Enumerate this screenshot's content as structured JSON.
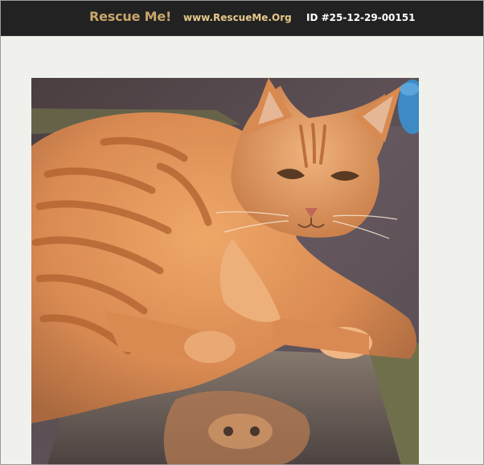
{
  "header": {
    "brand": "Rescue Me!",
    "site": "www.RescueMe.Org",
    "pet_id": "ID #25-12-29-00151"
  },
  "photo": {
    "subject": "orange-tabby-cat",
    "colors": {
      "fur": "#d98a52",
      "fur_light": "#eeb07a",
      "stripe": "#b86a36",
      "carpet": "#5a4e55",
      "bowl": "#3d8ac4",
      "mirror": "#7a7068"
    }
  },
  "theme": {
    "header_bg": "#222222",
    "brand_color": "#c9a66b",
    "link_color": "#e5c98a",
    "page_bg": "#f0f0ec"
  }
}
